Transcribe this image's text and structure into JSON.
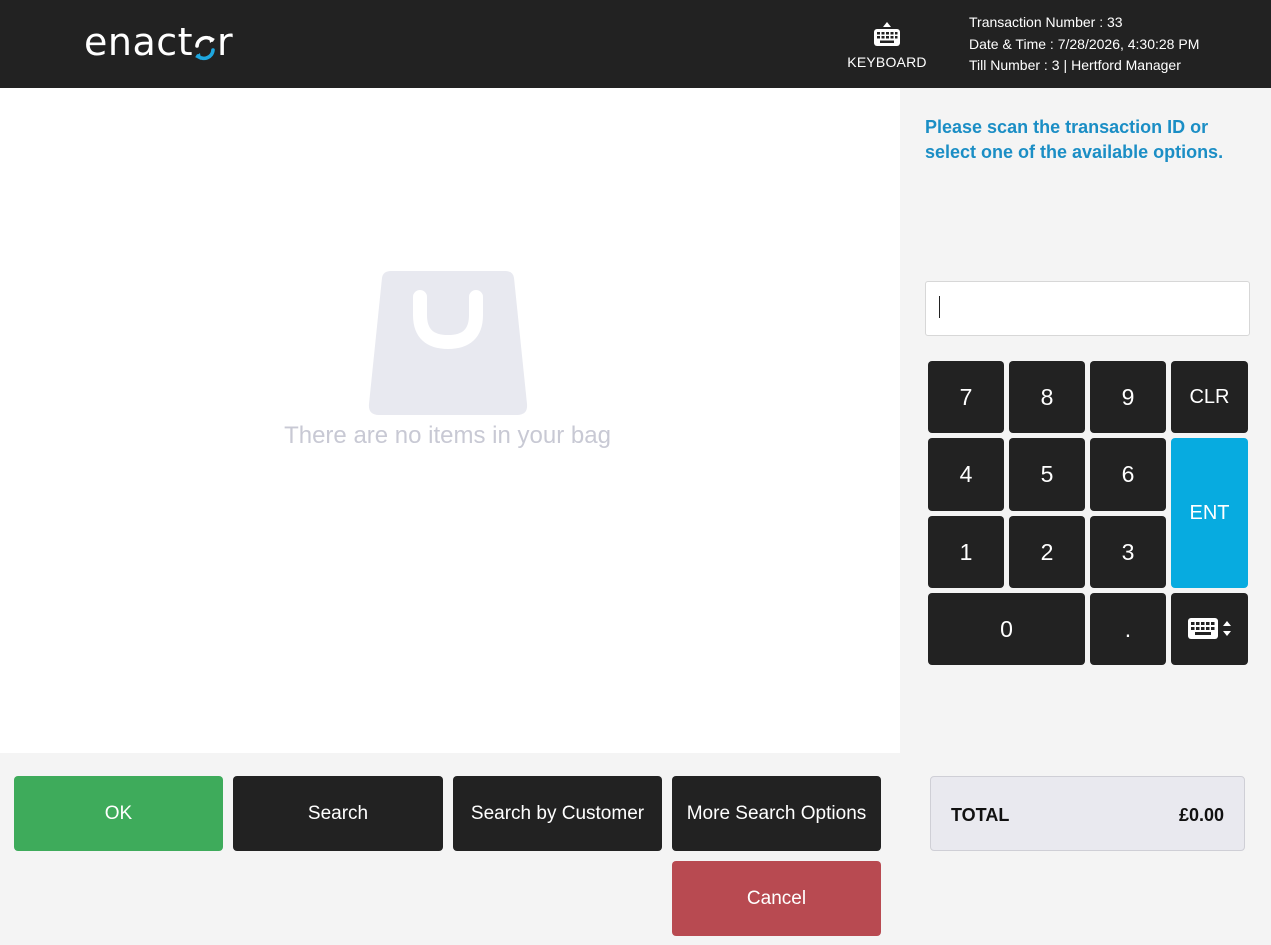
{
  "header": {
    "logo_text_main": "enact",
    "logo_text_tail": "r",
    "keyboard_label": "KEYBOARD",
    "transaction_number": "Transaction Number : 33",
    "date_time": "Date & Time : 7/28/2026, 4:30:28 PM",
    "till_number": "Till Number : 3",
    "separator": "|",
    "user": "Hertford Manager"
  },
  "bag": {
    "empty_message": "There are no items in your bag",
    "icon": "shopping-bag-icon"
  },
  "right_panel": {
    "prompt": "Please scan the transaction ID or select one of the available options.",
    "entry_value": "",
    "keypad": {
      "k7": "7",
      "k8": "8",
      "k9": "9",
      "clr": "CLR",
      "k4": "4",
      "k5": "5",
      "k6": "6",
      "ent": "ENT",
      "k1": "1",
      "k2": "2",
      "k3": "3",
      "k0": "0",
      "dot": ".",
      "toggle_icon": "keyboard-toggle-icon"
    }
  },
  "actions": {
    "ok": "OK",
    "search": "Search",
    "search_by_customer": "Search by Customer",
    "more_search_options": "More Search Options",
    "cancel": "Cancel"
  },
  "total": {
    "label": "TOTAL",
    "value": "£0.00"
  },
  "colors": {
    "header_bg": "#222222",
    "accent_blue": "#07abe0",
    "prompt_blue": "#1b8ec5",
    "ok_green": "#3eab5b",
    "cancel_red": "#b84a51"
  }
}
